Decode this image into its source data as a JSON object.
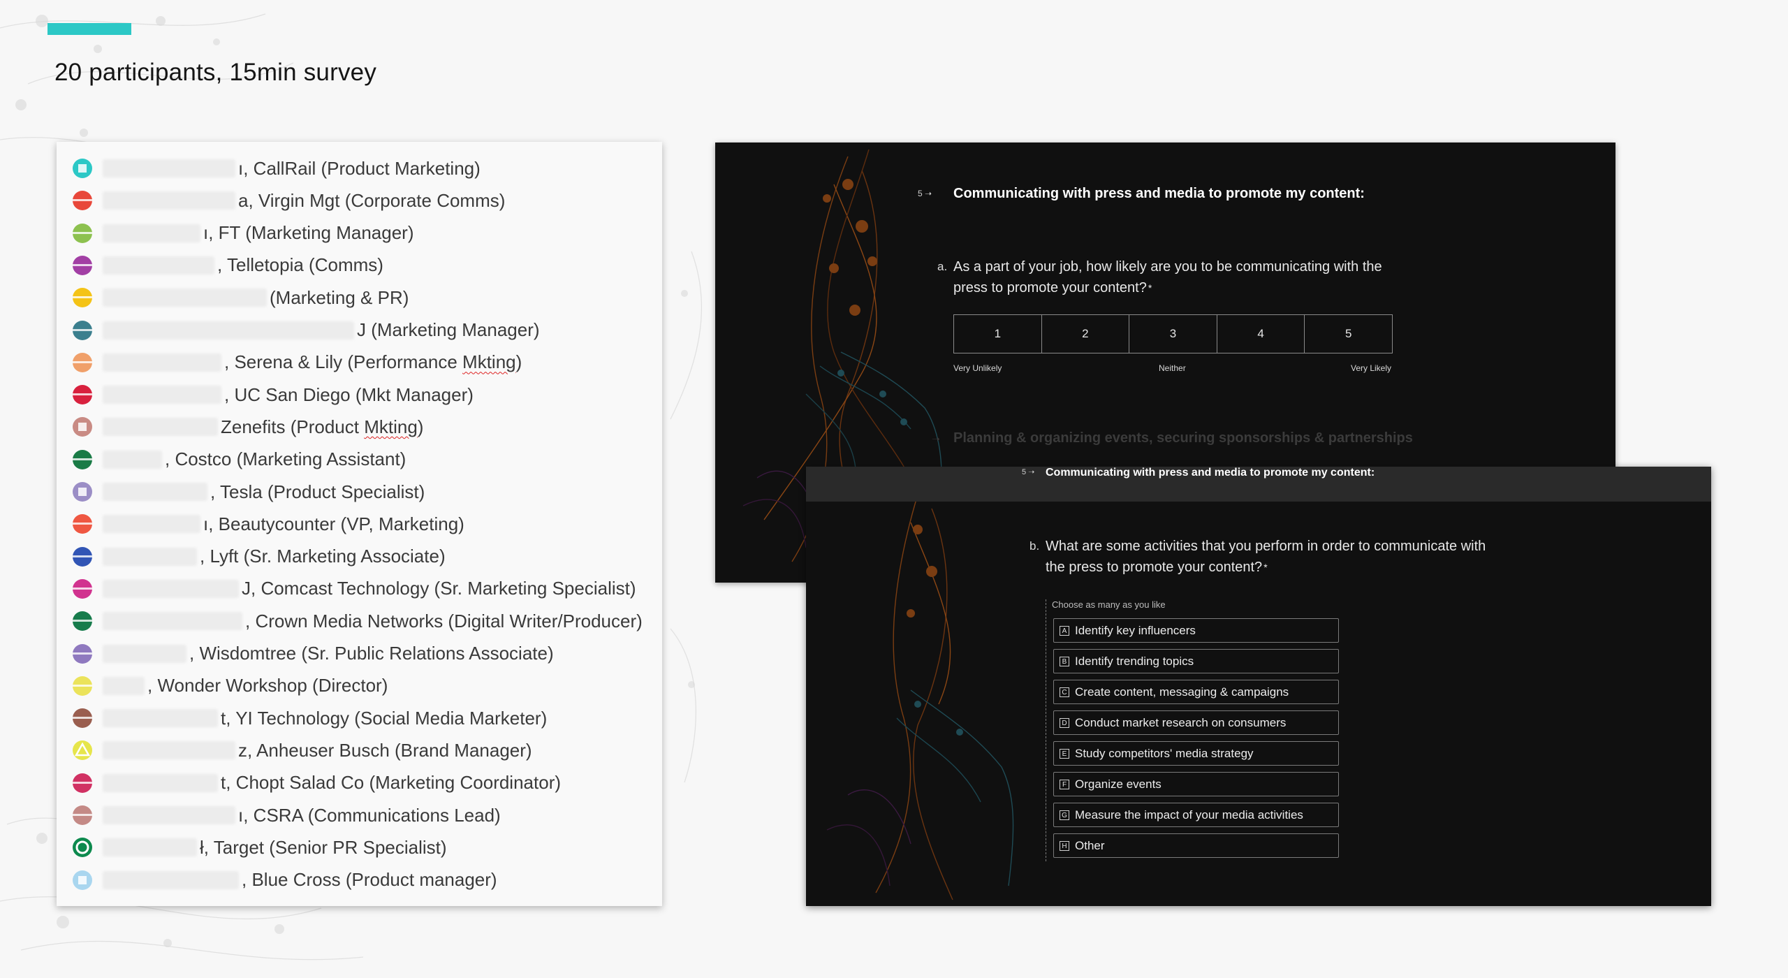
{
  "slide": {
    "title": "20 participants, 15min survey",
    "accent_color": "#2cc8c6"
  },
  "participants": [
    {
      "visible_text": "ı, CallRail (Product Marketing)",
      "icon": "teal-square-badge-icon",
      "color": "#2cc8c6"
    },
    {
      "visible_text": "a, Virgin Mgt (Corporate Comms)",
      "icon": "red-circle-badge-icon",
      "color": "#e8473a"
    },
    {
      "visible_text": "ı, FT (Marketing Manager)",
      "icon": "green-circle-badge-icon",
      "color": "#8dc14f"
    },
    {
      "visible_text": ", Telletopia (Comms)",
      "icon": "purple-circle-badge-icon",
      "color": "#a23fa4"
    },
    {
      "visible_text": "(Marketing & PR)",
      "icon": "yellow-circle-badge-icon",
      "color": "#f4c316"
    },
    {
      "visible_text": "J (Marketing Manager)",
      "icon": "slate-teal-circle-badge-icon",
      "color": "#3b7f8e"
    },
    {
      "visible_text": ", Serena & Lily (Performance Mkting)",
      "icon": "orange-circle-badge-icon",
      "color": "#f0a06a",
      "squiggle": "Mkting"
    },
    {
      "visible_text": ", UC San Diego (Mkt Manager)",
      "icon": "crimson-circle-badge-icon",
      "color": "#d8213e"
    },
    {
      "visible_text": "Zenefits (Product Mkting)",
      "icon": "rose-square-badge-icon",
      "color": "#c98b84",
      "squiggle": "Mkting"
    },
    {
      "visible_text": ", Costco (Marketing Assistant)",
      "icon": "dark-green-circle-badge-icon",
      "color": "#1a7b46"
    },
    {
      "visible_text": ", Tesla (Product Specialist)",
      "icon": "lavender-square-badge-icon",
      "color": "#9b8ec6"
    },
    {
      "visible_text": "ı, Beautycounter (VP, Marketing)",
      "icon": "coral-circle-badge-icon",
      "color": "#ef5742"
    },
    {
      "visible_text": ", Lyft  (Sr. Marketing Associate)",
      "icon": "blue-circle-badge-icon",
      "color": "#3155b5"
    },
    {
      "visible_text": "J, Comcast Technology (Sr. Marketing Specialist)",
      "icon": "magenta-circle-badge-icon",
      "color": "#d1338f"
    },
    {
      "visible_text": ", Crown Media Networks (Digital Writer/Producer)",
      "icon": "emerald-circle-badge-icon",
      "color": "#177c4c"
    },
    {
      "visible_text": ", Wisdomtree (Sr. Public Relations Associate)",
      "icon": "violet-circle-badge-icon",
      "color": "#8f79bf"
    },
    {
      "visible_text": ", Wonder Workshop (Director)",
      "icon": "pale-yellow-circle-badge-icon",
      "color": "#ebe35b"
    },
    {
      "visible_text": "t, YI Technology (Social Media Marketer)",
      "icon": "brown-circle-badge-icon",
      "color": "#9a5e4f"
    },
    {
      "visible_text": "z, Anheuser Busch (Brand Manager)",
      "icon": "yellow-triangle-badge-icon",
      "color": "#e6e54b"
    },
    {
      "visible_text": "t, Chopt Salad Co (Marketing Coordinator)",
      "icon": "raspberry-circle-badge-icon",
      "color": "#d13163"
    },
    {
      "visible_text": "ı, CSRA (Communications Lead)",
      "icon": "dusty-rose-circle-badge-icon",
      "color": "#c48a86"
    },
    {
      "visible_text": "ł, Target (Senior PR Specialist)",
      "icon": "green-ring-badge-icon",
      "color": "#0d8a4e"
    },
    {
      "visible_text": ", Blue Cross (Product manager)",
      "icon": "light-blue-square-badge-icon",
      "color": "#a9d6ef"
    }
  ],
  "survey_a": {
    "question_number": "5",
    "heading": "Communicating with press and media to promote my content:",
    "sub_letter": "a.",
    "question_line1": "As a part of your job, how likely are you to be communicating with the",
    "question_line2": "press to promote your content?",
    "required_mark": "*",
    "scale": [
      "1",
      "2",
      "3",
      "4",
      "5"
    ],
    "scale_labels": {
      "low": "Very Unlikely",
      "mid": "Neither",
      "high": "Very Likely"
    },
    "next_section": "Planning & organizing events, securing sponsorships & partnerships"
  },
  "survey_b": {
    "question_number": "5",
    "heading": "Communicating with press and media to promote my content:",
    "sub_letter": "b.",
    "question_line1": "What are some activities that you perform in order to communicate with",
    "question_line2": "the press to promote your content?",
    "required_mark": "*",
    "instruction": "Choose as many as you like",
    "options": [
      {
        "key": "A",
        "label": "Identify key influencers"
      },
      {
        "key": "B",
        "label": "Identify trending topics"
      },
      {
        "key": "C",
        "label": "Create content, messaging & campaigns"
      },
      {
        "key": "D",
        "label": "Conduct market research on consumers"
      },
      {
        "key": "E",
        "label": "Study competitors' media strategy"
      },
      {
        "key": "F",
        "label": "Organize events"
      },
      {
        "key": "G",
        "label": "Measure the impact of your media activities"
      },
      {
        "key": "H",
        "label": "Other"
      }
    ]
  }
}
